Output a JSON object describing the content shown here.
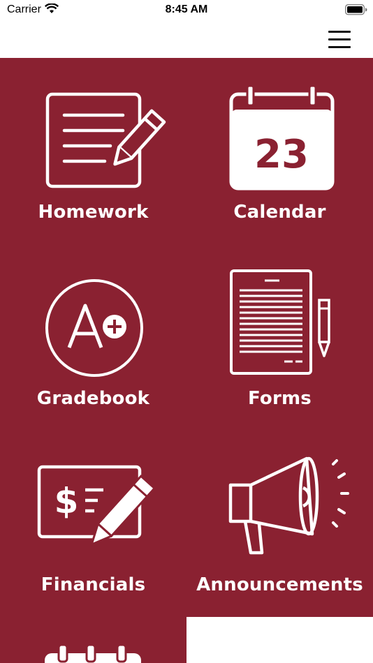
{
  "status": {
    "carrier": "Carrier",
    "time": "8:45 AM"
  },
  "calendar_icon": {
    "date_number": "23"
  },
  "tiles": [
    {
      "label": "Homework",
      "icon": "homework-icon"
    },
    {
      "label": "Calendar",
      "icon": "calendar-icon"
    },
    {
      "label": "Gradebook",
      "icon": "gradebook-icon"
    },
    {
      "label": "Forms",
      "icon": "forms-icon"
    },
    {
      "label": "Financials",
      "icon": "financials-icon"
    },
    {
      "label": "Announcements",
      "icon": "announcements-icon"
    }
  ],
  "colors": {
    "background": "#8a2131",
    "foreground": "#ffffff"
  }
}
